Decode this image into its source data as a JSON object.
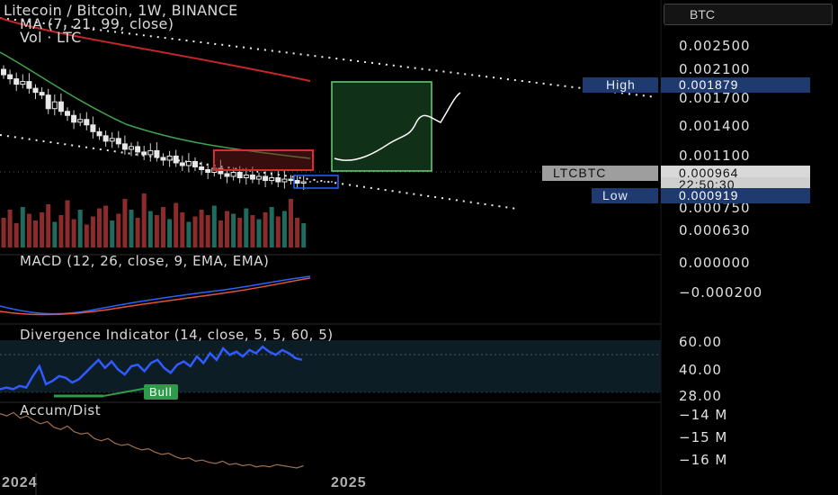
{
  "header": {
    "title": "Litecoin / Bitcoin, 1W, BINANCE",
    "ma_label": "MA (7, 21, 99, close)",
    "vol_label": "Vol · LTC",
    "currency_button": "BTC"
  },
  "price_axis": {
    "ticks": [
      "0.002500",
      "0.002100",
      "0.001700",
      "0.001400",
      "0.001100",
      "0.000750",
      "0.000630"
    ]
  },
  "price_tags": {
    "high_label": "High",
    "high_value": "0.001879",
    "symbol_label": "LTCBTC",
    "last_value": "0.000964",
    "countdown": "22:50:30",
    "low_label": "Low",
    "low_value": "0.000919"
  },
  "macd": {
    "label": "MACD (12, 26, close, 9, EMA, EMA)",
    "ticks": [
      "0.000000",
      "−0.000200"
    ]
  },
  "divergence": {
    "label": "Divergence Indicator (14, close, 5, 5, 60, 5)",
    "ticks": [
      "60.00",
      "40.00",
      "28.00"
    ],
    "bull_label": "Bull"
  },
  "accum": {
    "label": "Accum/Dist",
    "ticks": [
      "−14 M",
      "−15 M",
      "−16 M"
    ]
  },
  "time_axis": {
    "labels": [
      "2024",
      "2025"
    ]
  },
  "colors": {
    "background": "#000000",
    "up": "#e8e8e8",
    "down": "#ffffff",
    "ma_fast": "#3fa34d",
    "ma_slow": "#c62828",
    "volume_up": "#1f6b5e",
    "volume_down": "#8c2b2b",
    "macd": "#2962ff",
    "signal": "#e0563b",
    "rsi": "#2f5bff",
    "bull": "#2e9b4a",
    "accum": "#a0704f",
    "high_tag": "#1e3a6e",
    "low_tag": "#1e3a6e"
  },
  "chart_data": {
    "type": "candlestick",
    "title": "Litecoin / Bitcoin, 1W, BINANCE",
    "price_range": [
      0.0006,
      0.0027
    ],
    "high": 0.001879,
    "low": 0.000919,
    "last": 0.000964,
    "closes": [
      0.00175,
      0.00172,
      0.00168,
      0.0017,
      0.00165,
      0.00162,
      0.0016,
      0.0015,
      0.00155,
      0.00148,
      0.00145,
      0.0014,
      0.00142,
      0.00138,
      0.00133,
      0.0013,
      0.00126,
      0.00128,
      0.00124,
      0.0012,
      0.00122,
      0.00118,
      0.00116,
      0.00119,
      0.00114,
      0.00112,
      0.00115,
      0.0011,
      0.00108,
      0.00111,
      0.00107,
      0.00105,
      0.00103,
      0.00106,
      0.00102,
      0.001,
      0.00103,
      0.00099,
      0.00101,
      0.00098,
      0.001,
      0.00097,
      0.00099,
      0.00096,
      0.00098,
      0.00097,
      0.00095,
      0.00096
    ],
    "volume": [
      22,
      28,
      18,
      30,
      25,
      20,
      26,
      32,
      19,
      24,
      35,
      21,
      28,
      17,
      23,
      29,
      31,
      20,
      25,
      36,
      28,
      22,
      40,
      27,
      24,
      30,
      21,
      33,
      26,
      19,
      23,
      28,
      24,
      31,
      20,
      27,
      25,
      22,
      29,
      24,
      21,
      26,
      30,
      23,
      27,
      36,
      22,
      18
    ],
    "rsi_range": [
      28,
      60
    ],
    "accum_range_m": [
      -16.3,
      -13.6
    ]
  }
}
